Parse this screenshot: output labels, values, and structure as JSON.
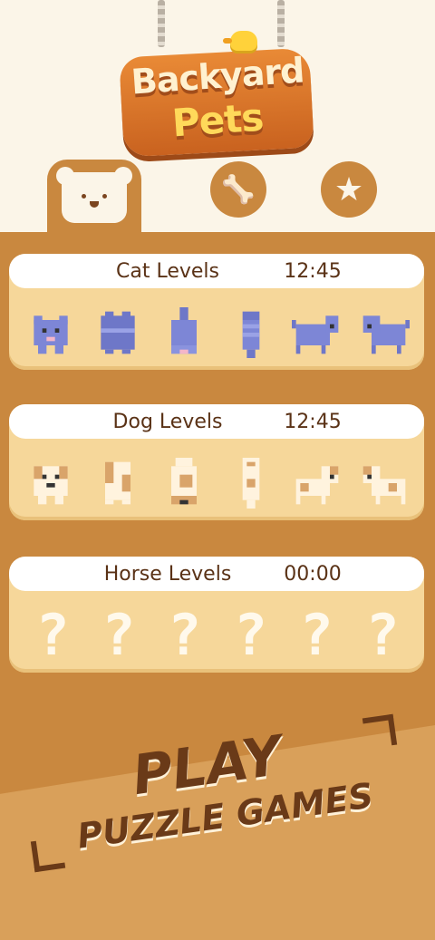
{
  "app": {
    "logo_line1": "Backyard",
    "logo_line2": "Pets"
  },
  "tabs": [
    {
      "name": "dog",
      "icon": "dog-face-icon",
      "active": true
    },
    {
      "name": "bone",
      "icon": "bone-icon",
      "glyph": "🦴",
      "active": false
    },
    {
      "name": "star",
      "icon": "star-icon",
      "glyph": "★",
      "active": false
    }
  ],
  "levels": [
    {
      "label": "Cat Levels",
      "time": "12:45"
    },
    {
      "label": "Dog Levels",
      "time": "12:45"
    },
    {
      "label": "Horse Levels",
      "time": "00:00"
    }
  ],
  "locked_glyph": "?",
  "promo": {
    "line1": "PLAY",
    "line2": "PUZZLE GAMES"
  },
  "colors": {
    "brown": "#c9883f",
    "cream": "#fbf5e8",
    "cat": "#7d86d6",
    "card": "#f6d79a",
    "text": "#5a3216"
  }
}
